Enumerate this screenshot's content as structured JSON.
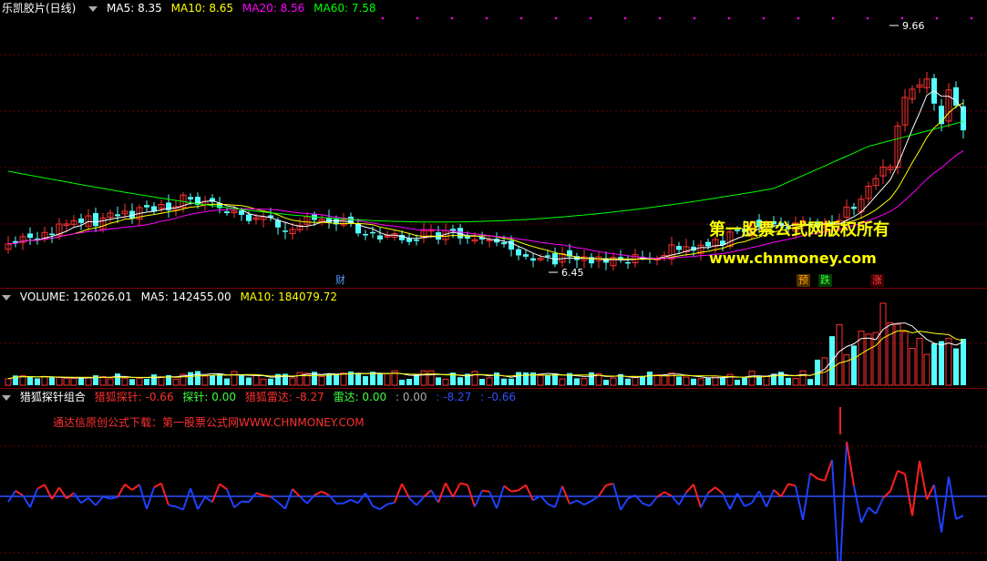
{
  "main": {
    "title": "乐凯胶片(日线)",
    "ma5_label": "MA5: 8.35",
    "ma10_label": "MA10: 8.65",
    "ma20_label": "MA20: 8.56",
    "ma60_label": "MA60: 7.58",
    "high_label": "9.66",
    "low_label": "6.45",
    "markers": {
      "cai": "财",
      "yu": "预",
      "die": "跌",
      "zhang": "涨"
    },
    "watermark_line1": "第一股票公式网版权所有",
    "watermark_line2": "www.chnmoney.com",
    "colors": {
      "ma5": "#ffffff",
      "ma10": "#ffff00",
      "ma20": "#ff00ff",
      "ma60": "#00ff00",
      "up": "#ff3232",
      "down": "#54ffff"
    }
  },
  "volume": {
    "volume_label": "VOLUME: 126026.01",
    "ma5_label": "MA5: 142455.00",
    "ma10_label": "MA10: 184079.72"
  },
  "indicator": {
    "name": "猎狐探针组合",
    "v1_label": "猎狐探针: -0.66",
    "v2_label": "探针: 0.00",
    "v3_label": "猎狐雷达: -8.27",
    "v4_label": "雷达: 0.00",
    "v5_label": ": 0.00",
    "v6_label": ": -8.27",
    "v7_label": ": -0.66",
    "note": "通达信原创公式下载：第一股票公式网WWW.CHNMONEY.COM"
  }
}
